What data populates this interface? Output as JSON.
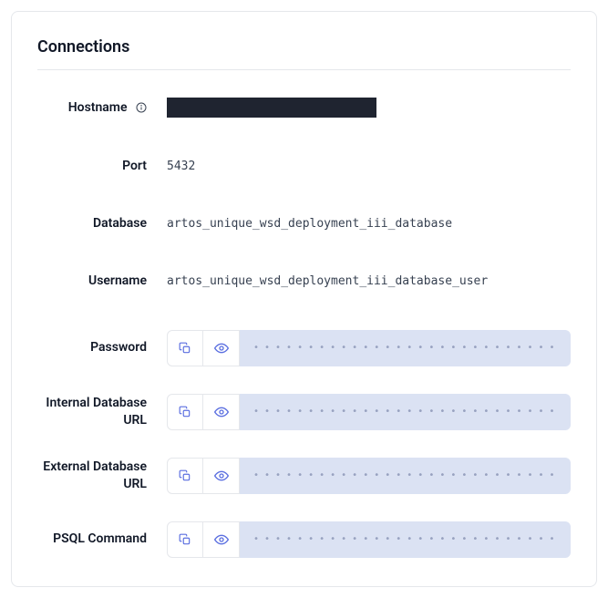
{
  "title": "Connections",
  "fields": {
    "hostname": {
      "label": "Hostname",
      "value": ""
    },
    "port": {
      "label": "Port",
      "value": "5432"
    },
    "database": {
      "label": "Database",
      "value": "artos_unique_wsd_deployment_iii_database"
    },
    "username": {
      "label": "Username",
      "value": "artos_unique_wsd_deployment_iii_database_user"
    },
    "password": {
      "label": "Password"
    },
    "internal_url": {
      "label": "Internal Database URL"
    },
    "external_url": {
      "label": "External Database URL"
    },
    "psql": {
      "label": "PSQL Command"
    }
  },
  "mask": "••••••••••••••••••••••••••••••••••••••••••••••••••••••••••••••••••••"
}
